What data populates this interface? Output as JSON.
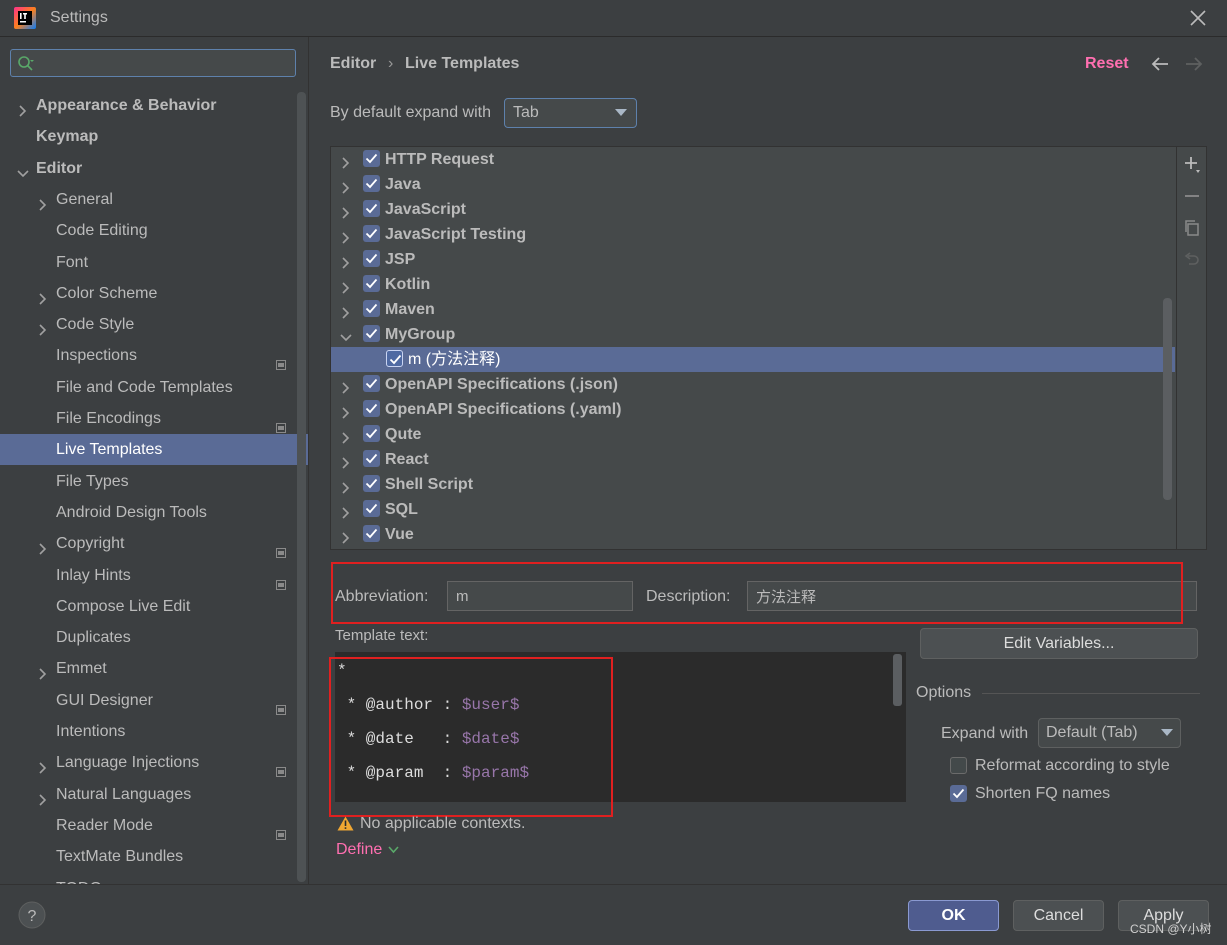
{
  "window": {
    "title": "Settings"
  },
  "search": {
    "placeholder": ""
  },
  "sidebar": {
    "items": [
      {
        "label": "Appearance & Behavior",
        "bold": true,
        "chevron": "right",
        "indent": 0
      },
      {
        "label": "Keymap",
        "bold": true,
        "chevron": null,
        "indent": 0
      },
      {
        "label": "Editor",
        "bold": true,
        "chevron": "down",
        "indent": 0
      },
      {
        "label": "General",
        "chevron": "right",
        "indent": 1
      },
      {
        "label": "Code Editing",
        "chevron": null,
        "indent": 1
      },
      {
        "label": "Font",
        "chevron": null,
        "indent": 1
      },
      {
        "label": "Color Scheme",
        "chevron": "right",
        "indent": 1
      },
      {
        "label": "Code Style",
        "chevron": "right",
        "indent": 1
      },
      {
        "label": "Inspections",
        "chevron": null,
        "indent": 1,
        "project": true
      },
      {
        "label": "File and Code Templates",
        "chevron": null,
        "indent": 1
      },
      {
        "label": "File Encodings",
        "chevron": null,
        "indent": 1,
        "project": true
      },
      {
        "label": "Live Templates",
        "chevron": null,
        "indent": 1,
        "selected": true
      },
      {
        "label": "File Types",
        "chevron": null,
        "indent": 1
      },
      {
        "label": "Android Design Tools",
        "chevron": null,
        "indent": 1
      },
      {
        "label": "Copyright",
        "chevron": "right",
        "indent": 1,
        "project": true
      },
      {
        "label": "Inlay Hints",
        "chevron": null,
        "indent": 1,
        "project": true
      },
      {
        "label": "Compose Live Edit",
        "chevron": null,
        "indent": 1
      },
      {
        "label": "Duplicates",
        "chevron": null,
        "indent": 1
      },
      {
        "label": "Emmet",
        "chevron": "right",
        "indent": 1
      },
      {
        "label": "GUI Designer",
        "chevron": null,
        "indent": 1,
        "project": true
      },
      {
        "label": "Intentions",
        "chevron": null,
        "indent": 1
      },
      {
        "label": "Language Injections",
        "chevron": "right",
        "indent": 1,
        "project": true
      },
      {
        "label": "Natural Languages",
        "chevron": "right",
        "indent": 1
      },
      {
        "label": "Reader Mode",
        "chevron": null,
        "indent": 1,
        "project": true
      },
      {
        "label": "TextMate Bundles",
        "chevron": null,
        "indent": 1
      },
      {
        "label": "TODO",
        "chevron": null,
        "indent": 1
      }
    ]
  },
  "breadcrumb": {
    "parent": "Editor",
    "separator": "›",
    "current": "Live Templates"
  },
  "header": {
    "reset_label": "Reset"
  },
  "expand_default": {
    "label": "By default expand with",
    "value": "Tab"
  },
  "template_groups": [
    {
      "label": "HTTP Request",
      "checked": true,
      "expanded": false
    },
    {
      "label": "Java",
      "checked": true,
      "expanded": false
    },
    {
      "label": "JavaScript",
      "checked": true,
      "expanded": false
    },
    {
      "label": "JavaScript Testing",
      "checked": true,
      "expanded": false
    },
    {
      "label": "JSP",
      "checked": true,
      "expanded": false
    },
    {
      "label": "Kotlin",
      "checked": true,
      "expanded": false
    },
    {
      "label": "Maven",
      "checked": true,
      "expanded": false
    },
    {
      "label": "MyGroup",
      "checked": true,
      "expanded": true
    },
    {
      "label": "m (方法注释)",
      "checked": true,
      "child": true,
      "selected": true
    },
    {
      "label": "OpenAPI Specifications (.json)",
      "checked": true,
      "expanded": false
    },
    {
      "label": "OpenAPI Specifications (.yaml)",
      "checked": true,
      "expanded": false
    },
    {
      "label": "Qute",
      "checked": true,
      "expanded": false
    },
    {
      "label": "React",
      "checked": true,
      "expanded": false
    },
    {
      "label": "Shell Script",
      "checked": true,
      "expanded": false
    },
    {
      "label": "SQL",
      "checked": true,
      "expanded": false
    },
    {
      "label": "Vue",
      "checked": true,
      "expanded": false
    }
  ],
  "editor": {
    "abbreviation_label": "Abbreviation:",
    "abbreviation_value": "m",
    "description_label": "Description:",
    "description_value": "方法注释",
    "template_text_label": "Template text:",
    "template_lines": [
      {
        "prefix": "*",
        "var": ""
      },
      {
        "prefix": " * @author : ",
        "var": "$user$"
      },
      {
        "prefix": " * @date   : ",
        "var": "$date$"
      },
      {
        "prefix": " * @param  : ",
        "var": "$param$"
      }
    ],
    "edit_variables_label": "Edit Variables...",
    "options_label": "Options",
    "expand_with_label": "Expand with",
    "expand_with_value": "Default (Tab)",
    "reformat_label": "Reformat according to style",
    "reformat_checked": false,
    "shorten_label": "Shorten FQ names",
    "shorten_checked": true,
    "warning_text": "No applicable contexts.",
    "define_label": "Define"
  },
  "footer": {
    "ok_label": "OK",
    "cancel_label": "Cancel",
    "apply_label": "Apply",
    "watermark": "CSDN @Y小树"
  },
  "colors": {
    "background": "#3c3f41",
    "selection": "#5a6b96",
    "accent_link": "#ff6fb0",
    "highlight_box": "#e02020",
    "template_variable": "#9876aa"
  }
}
